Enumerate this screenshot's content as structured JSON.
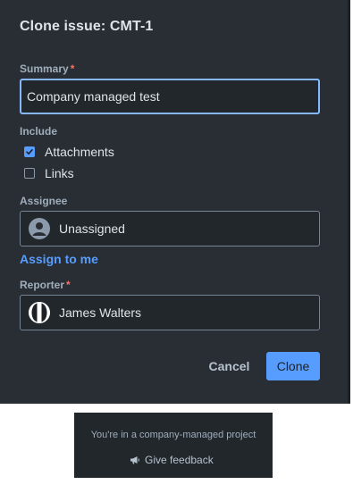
{
  "dialog": {
    "title": "Clone issue: CMT-1",
    "summary": {
      "label": "Summary",
      "required_mark": "*",
      "value": "Company managed test"
    },
    "include": {
      "label": "Include",
      "options": [
        {
          "label": "Attachments",
          "checked": true
        },
        {
          "label": "Links",
          "checked": false
        }
      ]
    },
    "assignee": {
      "label": "Assignee",
      "value": "Unassigned",
      "assign_to_me": "Assign to me"
    },
    "reporter": {
      "label": "Reporter",
      "required_mark": "*",
      "value": "James Walters"
    },
    "buttons": {
      "cancel": "Cancel",
      "clone": "Clone"
    },
    "colors": {
      "background": "#282e33",
      "accent": "#579dff",
      "required": "#f87168"
    }
  },
  "flag": {
    "message": "You're in a company-managed project",
    "feedback_label": "Give feedback",
    "feedback_icon": "megaphone-icon"
  }
}
